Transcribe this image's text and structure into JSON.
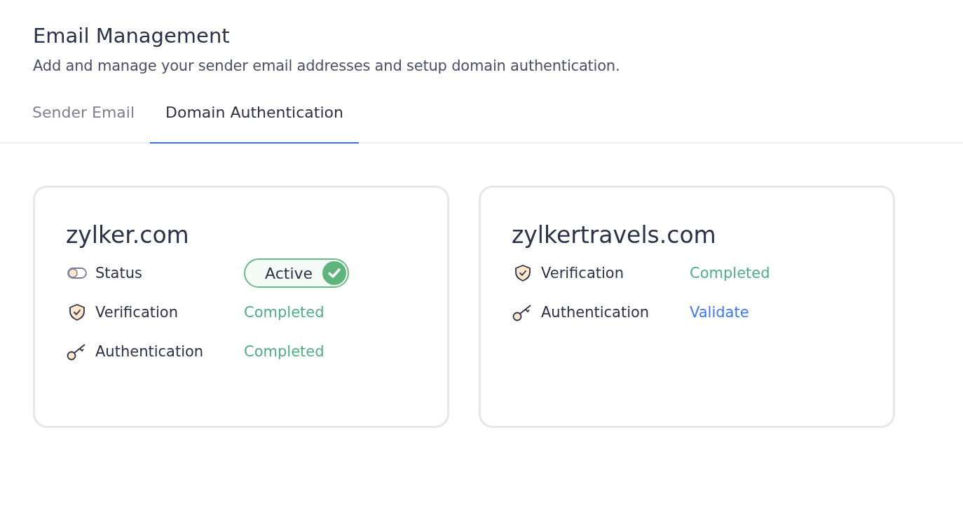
{
  "header": {
    "title": "Email Management",
    "subtitle": "Add and manage your sender email addresses and setup domain authentication."
  },
  "tabs": [
    {
      "label": "Sender Email",
      "selected": false
    },
    {
      "label": "Domain Authentication",
      "selected": true
    }
  ],
  "domains": [
    {
      "name": "zylker.com",
      "rows": [
        {
          "kind": "status",
          "label": "Status",
          "value": "Active",
          "on": true
        },
        {
          "kind": "verification",
          "label": "Verification",
          "value": "Completed",
          "link": false
        },
        {
          "kind": "authentication",
          "label": "Authentication",
          "value": "Completed",
          "link": false
        }
      ]
    },
    {
      "name": "zylkertravels.com",
      "rows": [
        {
          "kind": "verification",
          "label": "Verification",
          "value": "Completed",
          "link": false
        },
        {
          "kind": "authentication",
          "label": "Authentication",
          "value": "Validate",
          "link": true
        }
      ]
    }
  ]
}
